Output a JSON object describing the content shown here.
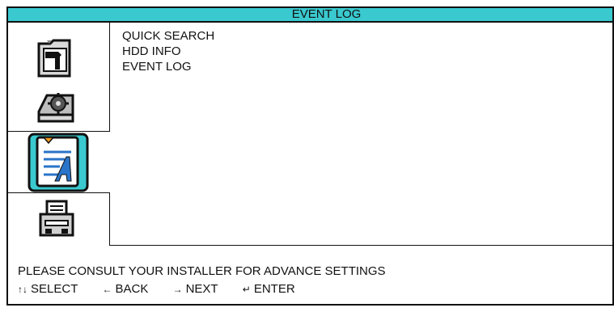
{
  "header": {
    "title": "EVENT LOG"
  },
  "sidebar": {
    "icons": [
      {
        "name": "system-tools-icon"
      },
      {
        "name": "hdd-settings-icon"
      },
      {
        "name": "event-log-icon",
        "selected": true
      },
      {
        "name": "backup-icon"
      }
    ]
  },
  "menu": {
    "items": [
      {
        "label": "QUICK SEARCH"
      },
      {
        "label": "HDD INFO"
      },
      {
        "label": "EVENT LOG"
      }
    ]
  },
  "footer": {
    "note": "PLEASE CONSULT YOUR INSTALLER FOR ADVANCE SETTINGS",
    "keys": [
      {
        "glyph": "↑↓",
        "label": "SELECT"
      },
      {
        "glyph": "←",
        "label": "BACK"
      },
      {
        "glyph": "→",
        "label": "NEXT"
      },
      {
        "glyph": "↵",
        "label": "ENTER"
      }
    ]
  },
  "colors": {
    "title_bar": "#39c9cf",
    "selected_icon_bg": "#39c9cf",
    "accent_orange": "#f39a1e"
  }
}
